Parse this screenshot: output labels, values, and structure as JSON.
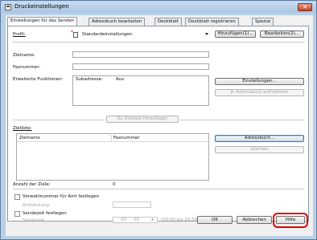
{
  "window": {
    "title": "Druckeinstellungen",
    "close_label": "✕"
  },
  "tabs": [
    {
      "label": "Einstellungen für das Senden"
    },
    {
      "label": "Adressbuch bearbeiten"
    },
    {
      "label": "Deckblatt"
    },
    {
      "label": "Deckblatt registrieren"
    },
    {
      "label": "Spezial"
    }
  ],
  "profile": {
    "label": "Profil:",
    "value": "Standardeinstellungen",
    "add_button": "Hinzufügen(1)...",
    "edit_button": "Bearbeiten(2)..."
  },
  "fields": {
    "target_name_label": "Zielname:",
    "fax_number_label": "Faxnummer:",
    "extended_label": "Erweiterte Funktionen:",
    "subaddress_label": "Subadresse:",
    "subaddress_value": "Aus",
    "settings_button": "Einstellungen...",
    "add_to_addressbook_button": "In Adressbuch aufnehmen"
  },
  "target_list": {
    "add_button": "Zu Zielliste hinzufügen",
    "label": "Zielliste:",
    "columns": [
      "Zielname",
      "Faxnummer"
    ],
    "addressbook_button": "Adressbuch...",
    "delete_button": "Löschen",
    "count_label": "Anzahl der Ziele:",
    "count_value": "0"
  },
  "prefix": {
    "checkbox_label": "Vorwahlnummer für Amt festlegen",
    "field_label": "Amtsholung"
  },
  "send_time": {
    "checkbox_label": "Sendezeit festlegen",
    "field_label": "Sendezeit",
    "hours": "00",
    "minutes": "00",
    "range_hint": "(00:00 bis 23:59)"
  },
  "footer": {
    "ok": "OK",
    "cancel": "Abbrechen",
    "help": "Hilfe"
  }
}
